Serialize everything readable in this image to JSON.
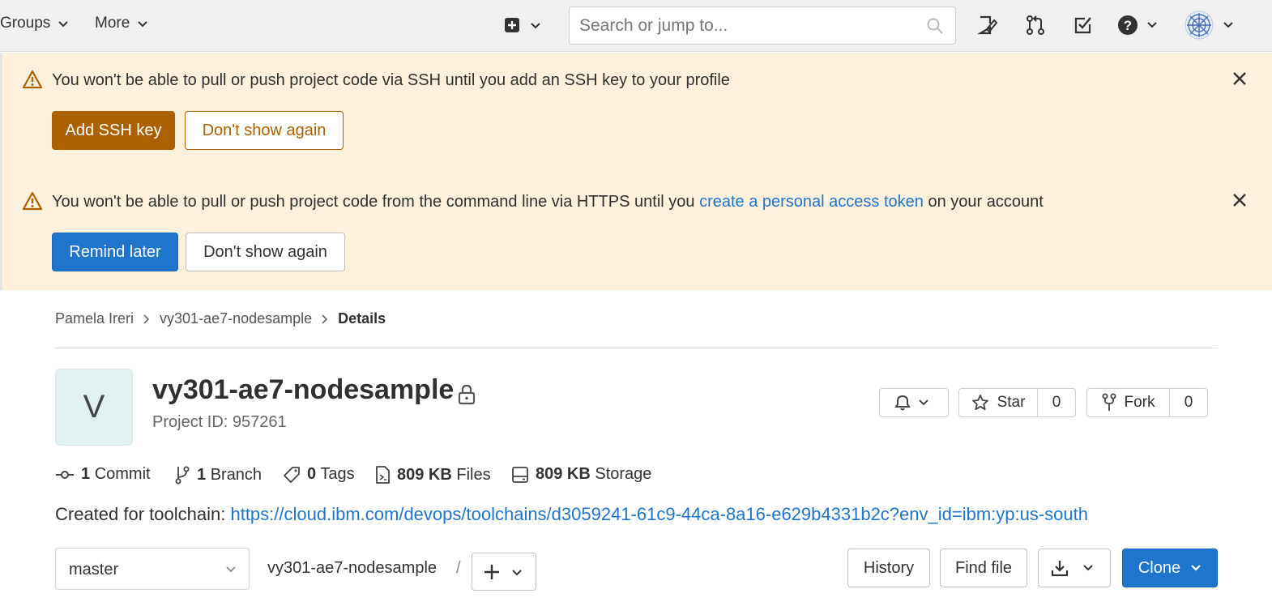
{
  "navbar": {
    "groups_label": "Groups",
    "more_label": "More",
    "search_placeholder": "Search or jump to..."
  },
  "alerts": [
    {
      "message": "You won't be able to pull or push project code via SSH until you add an SSH key to your profile",
      "primary_label": "Add SSH key",
      "secondary_label": "Don't show again"
    },
    {
      "message_before": "You won't be able to pull or push project code from the command line via HTTPS until you",
      "link_text": "create a personal access token",
      "message_after": "on your account",
      "primary_label": "Remind later",
      "secondary_label": "Don't show again"
    }
  ],
  "breadcrumb": {
    "items": [
      "Pamela Ireri",
      "vy301-ae7-nodesample"
    ],
    "current": "Details"
  },
  "project": {
    "avatar_letter": "V",
    "name": "vy301-ae7-nodesample",
    "id_text": "Project ID: 957261",
    "star_label": "Star",
    "star_count": "0",
    "fork_label": "Fork",
    "fork_count": "0"
  },
  "stats": {
    "commits_count": "1",
    "commits_label": "Commit",
    "branches_count": "1",
    "branches_label": "Branch",
    "tags_count": "0",
    "tags_label": "Tags",
    "files_size": "809 KB",
    "files_label": "Files",
    "storage_size": "809 KB",
    "storage_label": "Storage"
  },
  "toolchain": {
    "label": "Created for toolchain:",
    "url": "https://cloud.ibm.com/devops/toolchains/d3059241-61c9-44ca-8a16-e629b4331b2c?env_id=ibm:yp:us-south"
  },
  "repo": {
    "branch": "master",
    "path": "vy301-ae7-nodesample",
    "path_sep": "/",
    "history_label": "History",
    "find_file_label": "Find file",
    "clone_label": "Clone"
  },
  "colors": {
    "alert_bg": "#fdf1dd",
    "warning": "#ab6100",
    "primary": "#1f75cb"
  }
}
